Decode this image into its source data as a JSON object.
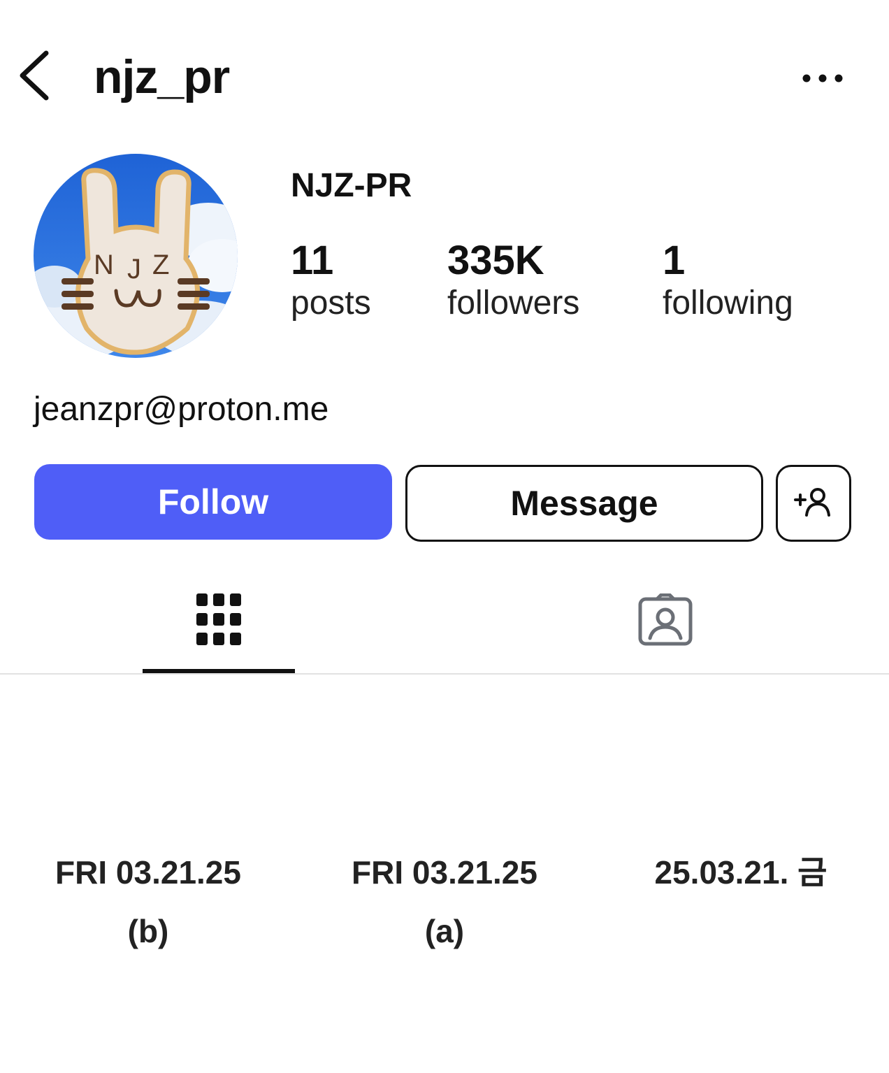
{
  "header": {
    "username": "njz_pr",
    "back_icon": "chevron-left-icon",
    "more_icon": "more-horizontal-icon"
  },
  "profile": {
    "display_name": "NJZ-PR",
    "avatar_alt": "bunny cookie avatar",
    "avatar_letters": "NJZ",
    "stats": [
      {
        "value": "11",
        "label": "posts"
      },
      {
        "value": "335K",
        "label": "followers"
      },
      {
        "value": "1",
        "label": "following"
      }
    ],
    "bio": "jeanzpr@proton.me"
  },
  "actions": {
    "follow_label": "Follow",
    "message_label": "Message",
    "add_user_icon": "add-user-icon",
    "follow_color": "#4f5ef7"
  },
  "tabs": [
    {
      "name": "posts-grid",
      "icon": "grid-icon",
      "active": true
    },
    {
      "name": "tagged",
      "icon": "tagged-user-icon",
      "active": false
    }
  ],
  "posts": [
    {
      "date": "FRI 03.21.25",
      "sub": "(b)"
    },
    {
      "date": "FRI 03.21.25",
      "sub": "(a)"
    },
    {
      "date": "25.03.21. 금",
      "sub": ""
    }
  ]
}
